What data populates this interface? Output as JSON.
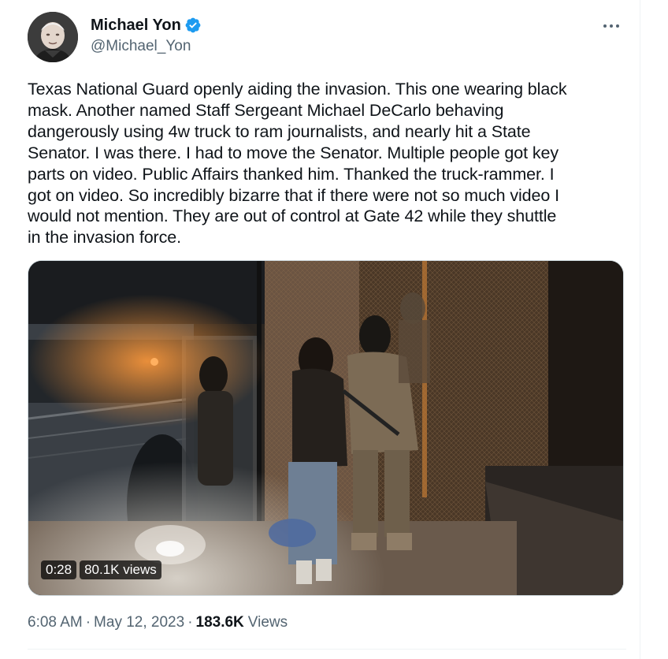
{
  "author": {
    "display_name": "Michael Yon",
    "handle": "@Michael_Yon",
    "verified": true,
    "avatar_icon": "profile-photo",
    "verified_color": "#1d9bf0"
  },
  "menu": {
    "more_icon": "ellipsis-icon",
    "more_label": "···"
  },
  "tweet": {
    "text": "Texas National Guard openly aiding the invasion.  This one wearing black\nmask.  Another named Staff Sergeant Michael DeCarlo behaving\ndangerously using 4w truck to ram journalists, and nearly hit a State\nSenator.  I was there.  I had to move the Senator.  Multiple people got key\nparts on video.  Public Affairs thanked him.  Thanked the truck-rammer.  I\ngot on video.  So incredibly bizarre that if there were not so much video I\nwould not mention.  They are out of control at Gate 42 while they shuttle\nin the invasion force."
  },
  "video": {
    "duration": "0:28",
    "views": "80.1K views"
  },
  "meta": {
    "time": "6:08 AM",
    "separator": "·",
    "date": "May 12, 2023",
    "views_count": "183.6K",
    "views_label": "Views"
  },
  "colors": {
    "text_primary": "#0f1419",
    "text_secondary": "#536471",
    "border": "#cfd9de",
    "accent": "#1d9bf0"
  }
}
